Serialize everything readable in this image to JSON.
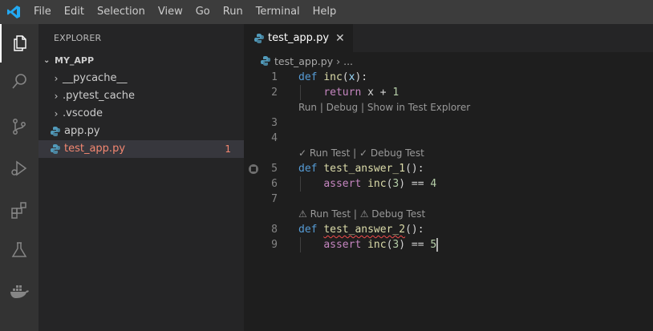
{
  "menu": [
    "File",
    "Edit",
    "Selection",
    "View",
    "Go",
    "Run",
    "Terminal",
    "Help"
  ],
  "activity_icons": [
    "explorer-icon",
    "search-icon",
    "source-control-icon",
    "run-debug-icon",
    "extensions-icon",
    "testing-icon",
    "docker-icon"
  ],
  "sidebar": {
    "header": "EXPLORER",
    "folder": "MY_APP",
    "items": [
      {
        "label": "__pycache__",
        "type": "folder"
      },
      {
        "label": ".pytest_cache",
        "type": "folder"
      },
      {
        "label": ".vscode",
        "type": "folder"
      },
      {
        "label": "app.py",
        "type": "python"
      },
      {
        "label": "test_app.py",
        "type": "python",
        "badge": "1"
      }
    ]
  },
  "editor": {
    "tab": {
      "label": "test_app.py",
      "close": "✕"
    },
    "breadcrumb": {
      "file": "test_app.py",
      "sep": "›",
      "more": "..."
    },
    "lines": {
      "l1": {
        "n": "1",
        "kw": "def",
        "fn": "inc",
        "open": "(",
        "param": "x",
        "close": "):"
      },
      "l2": {
        "n": "2",
        "kw": "return",
        "rest": " x + ",
        "num": "1"
      },
      "lens1": "Run | Debug | Show in Test Explorer",
      "l3": {
        "n": "3"
      },
      "l4": {
        "n": "4"
      },
      "lens2": "✓ Run Test | ✓ Debug Test",
      "l5": {
        "n": "5",
        "kw": "def",
        "fn": "test_answer_1",
        "close": "():"
      },
      "l6": {
        "n": "6",
        "kw": "assert",
        "call": " inc",
        "mid": "(",
        "num": "3",
        "rest": ") == ",
        "num2": "4"
      },
      "l7": {
        "n": "7"
      },
      "lens3": "⚠ Run Test | ⚠ Debug Test",
      "l8": {
        "n": "8",
        "kw": "def",
        "fn": "test_answer_2",
        "close": "():"
      },
      "l9": {
        "n": "9",
        "kw": "assert",
        "call": " inc",
        "mid": "(",
        "num": "3",
        "rest": ") == ",
        "num2": "5"
      }
    }
  },
  "colors": {
    "accent": "#0078d4",
    "error": "#f48771",
    "python": "#519aba"
  }
}
